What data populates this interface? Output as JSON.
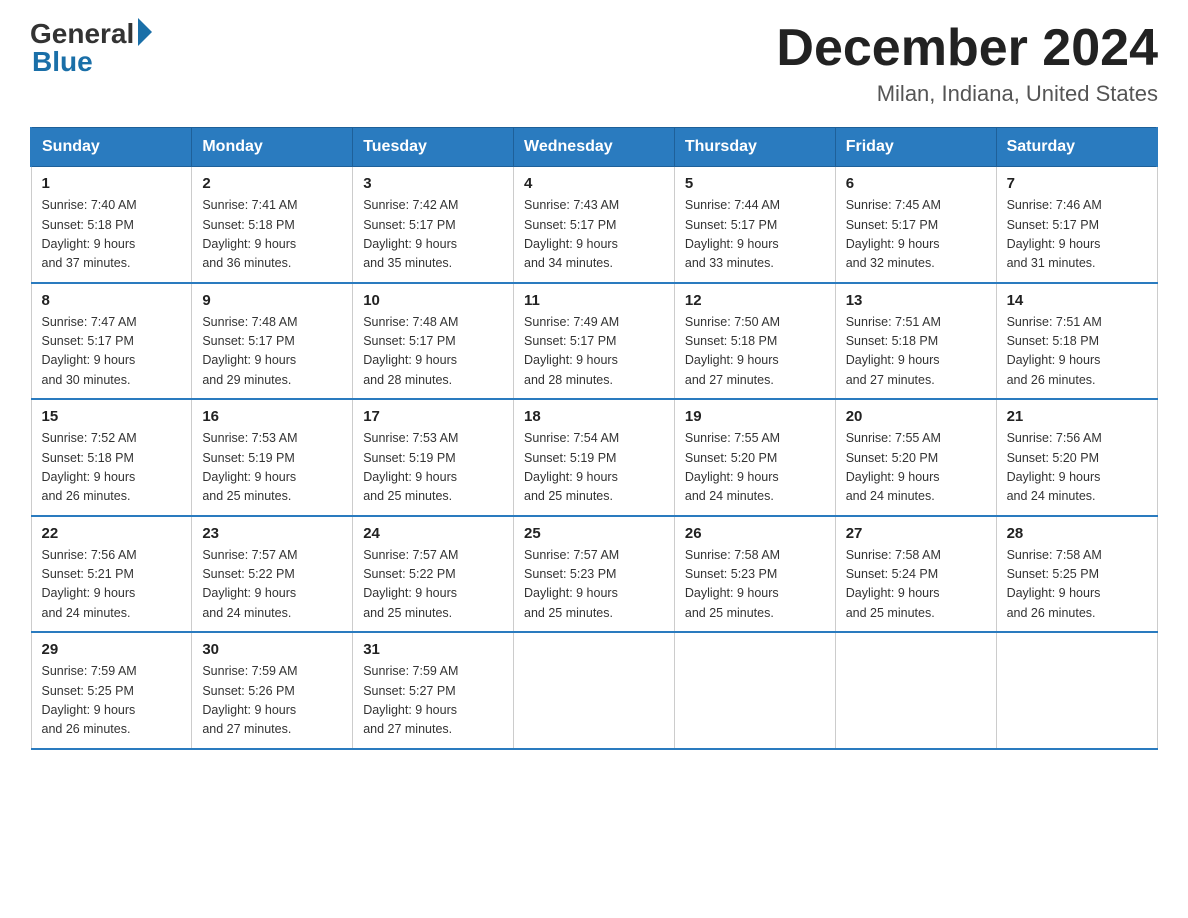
{
  "logo": {
    "general": "General",
    "blue": "Blue"
  },
  "title": "December 2024",
  "location": "Milan, Indiana, United States",
  "days_of_week": [
    "Sunday",
    "Monday",
    "Tuesday",
    "Wednesday",
    "Thursday",
    "Friday",
    "Saturday"
  ],
  "weeks": [
    [
      {
        "day": "1",
        "sunrise": "7:40 AM",
        "sunset": "5:18 PM",
        "daylight": "9 hours and 37 minutes."
      },
      {
        "day": "2",
        "sunrise": "7:41 AM",
        "sunset": "5:18 PM",
        "daylight": "9 hours and 36 minutes."
      },
      {
        "day": "3",
        "sunrise": "7:42 AM",
        "sunset": "5:17 PM",
        "daylight": "9 hours and 35 minutes."
      },
      {
        "day": "4",
        "sunrise": "7:43 AM",
        "sunset": "5:17 PM",
        "daylight": "9 hours and 34 minutes."
      },
      {
        "day": "5",
        "sunrise": "7:44 AM",
        "sunset": "5:17 PM",
        "daylight": "9 hours and 33 minutes."
      },
      {
        "day": "6",
        "sunrise": "7:45 AM",
        "sunset": "5:17 PM",
        "daylight": "9 hours and 32 minutes."
      },
      {
        "day": "7",
        "sunrise": "7:46 AM",
        "sunset": "5:17 PM",
        "daylight": "9 hours and 31 minutes."
      }
    ],
    [
      {
        "day": "8",
        "sunrise": "7:47 AM",
        "sunset": "5:17 PM",
        "daylight": "9 hours and 30 minutes."
      },
      {
        "day": "9",
        "sunrise": "7:48 AM",
        "sunset": "5:17 PM",
        "daylight": "9 hours and 29 minutes."
      },
      {
        "day": "10",
        "sunrise": "7:48 AM",
        "sunset": "5:17 PM",
        "daylight": "9 hours and 28 minutes."
      },
      {
        "day": "11",
        "sunrise": "7:49 AM",
        "sunset": "5:17 PM",
        "daylight": "9 hours and 28 minutes."
      },
      {
        "day": "12",
        "sunrise": "7:50 AM",
        "sunset": "5:18 PM",
        "daylight": "9 hours and 27 minutes."
      },
      {
        "day": "13",
        "sunrise": "7:51 AM",
        "sunset": "5:18 PM",
        "daylight": "9 hours and 27 minutes."
      },
      {
        "day": "14",
        "sunrise": "7:51 AM",
        "sunset": "5:18 PM",
        "daylight": "9 hours and 26 minutes."
      }
    ],
    [
      {
        "day": "15",
        "sunrise": "7:52 AM",
        "sunset": "5:18 PM",
        "daylight": "9 hours and 26 minutes."
      },
      {
        "day": "16",
        "sunrise": "7:53 AM",
        "sunset": "5:19 PM",
        "daylight": "9 hours and 25 minutes."
      },
      {
        "day": "17",
        "sunrise": "7:53 AM",
        "sunset": "5:19 PM",
        "daylight": "9 hours and 25 minutes."
      },
      {
        "day": "18",
        "sunrise": "7:54 AM",
        "sunset": "5:19 PM",
        "daylight": "9 hours and 25 minutes."
      },
      {
        "day": "19",
        "sunrise": "7:55 AM",
        "sunset": "5:20 PM",
        "daylight": "9 hours and 24 minutes."
      },
      {
        "day": "20",
        "sunrise": "7:55 AM",
        "sunset": "5:20 PM",
        "daylight": "9 hours and 24 minutes."
      },
      {
        "day": "21",
        "sunrise": "7:56 AM",
        "sunset": "5:20 PM",
        "daylight": "9 hours and 24 minutes."
      }
    ],
    [
      {
        "day": "22",
        "sunrise": "7:56 AM",
        "sunset": "5:21 PM",
        "daylight": "9 hours and 24 minutes."
      },
      {
        "day": "23",
        "sunrise": "7:57 AM",
        "sunset": "5:22 PM",
        "daylight": "9 hours and 24 minutes."
      },
      {
        "day": "24",
        "sunrise": "7:57 AM",
        "sunset": "5:22 PM",
        "daylight": "9 hours and 25 minutes."
      },
      {
        "day": "25",
        "sunrise": "7:57 AM",
        "sunset": "5:23 PM",
        "daylight": "9 hours and 25 minutes."
      },
      {
        "day": "26",
        "sunrise": "7:58 AM",
        "sunset": "5:23 PM",
        "daylight": "9 hours and 25 minutes."
      },
      {
        "day": "27",
        "sunrise": "7:58 AM",
        "sunset": "5:24 PM",
        "daylight": "9 hours and 25 minutes."
      },
      {
        "day": "28",
        "sunrise": "7:58 AM",
        "sunset": "5:25 PM",
        "daylight": "9 hours and 26 minutes."
      }
    ],
    [
      {
        "day": "29",
        "sunrise": "7:59 AM",
        "sunset": "5:25 PM",
        "daylight": "9 hours and 26 minutes."
      },
      {
        "day": "30",
        "sunrise": "7:59 AM",
        "sunset": "5:26 PM",
        "daylight": "9 hours and 27 minutes."
      },
      {
        "day": "31",
        "sunrise": "7:59 AM",
        "sunset": "5:27 PM",
        "daylight": "9 hours and 27 minutes."
      },
      null,
      null,
      null,
      null
    ]
  ]
}
